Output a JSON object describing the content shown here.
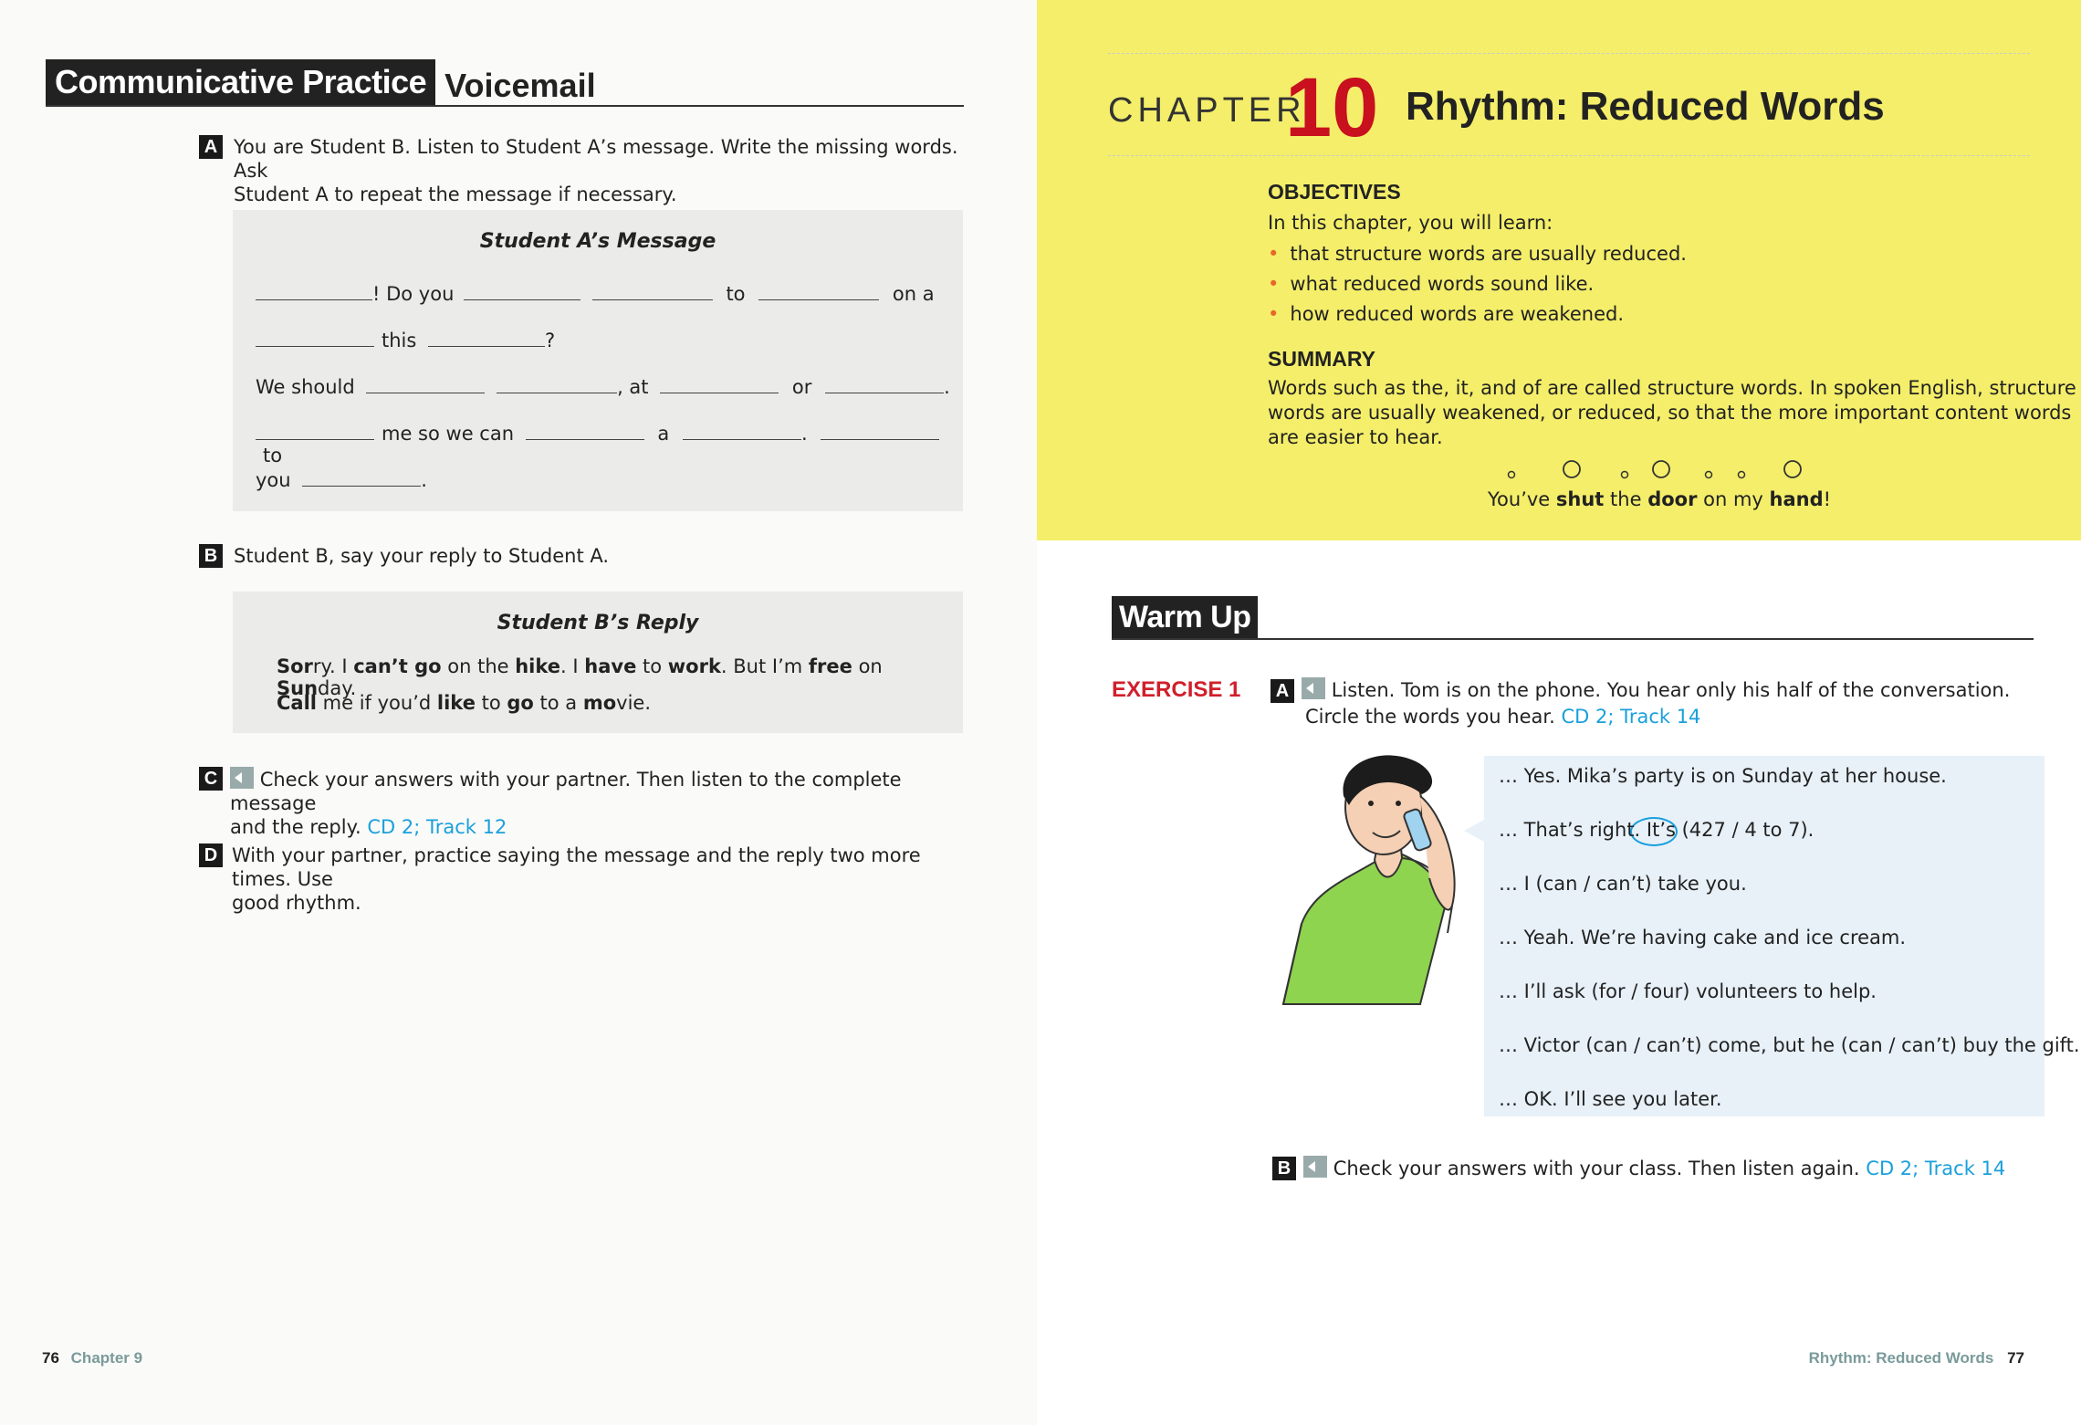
{
  "left": {
    "header_box": "Communicative Practice",
    "header_title": "Voicemail",
    "a_badge": "A",
    "a_text_1": "You are Student B. Listen to Student A’s message. Write the missing words. Ask",
    "a_text_2": "Student A to repeat the message if necessary.",
    "box_a_title": "Student A’s Message",
    "msg": {
      "r1_a": "! Do you",
      "r1_b": "to",
      "r1_c": "on a",
      "r2_a": "this",
      "r2_b": "?",
      "r3_a": "We should",
      "r3_b": ", at",
      "r3_c": "or",
      "r3_d": ".",
      "r4_a": "me so we can",
      "r4_b": "a",
      "r4_c": ".",
      "r4_d": "to",
      "r5_a": "you",
      "r5_b": "."
    },
    "b_badge": "B",
    "b_text": "Student B, say your reply to Student A.",
    "box_b_title": "Student B’s Reply",
    "reply_line1": [
      {
        "t": "Sor",
        "b": true
      },
      {
        "t": "ry. I ",
        "b": false
      },
      {
        "t": "can’t go",
        "b": true
      },
      {
        "t": " on the ",
        "b": false
      },
      {
        "t": "hike",
        "b": true
      },
      {
        "t": ". I ",
        "b": false
      },
      {
        "t": "have",
        "b": true
      },
      {
        "t": " to ",
        "b": false
      },
      {
        "t": "work",
        "b": true
      },
      {
        "t": ". But I’m ",
        "b": false
      },
      {
        "t": "free",
        "b": true
      },
      {
        "t": " on ",
        "b": false
      },
      {
        "t": "Sun",
        "b": true
      },
      {
        "t": "day.",
        "b": false
      }
    ],
    "reply_line2": [
      {
        "t": "Call",
        "b": true
      },
      {
        "t": " me if you’d ",
        "b": false
      },
      {
        "t": "like",
        "b": true
      },
      {
        "t": " to ",
        "b": false
      },
      {
        "t": "go",
        "b": true
      },
      {
        "t": " to a ",
        "b": false
      },
      {
        "t": "mo",
        "b": true
      },
      {
        "t": "vie.",
        "b": false
      }
    ],
    "c_badge": "C",
    "c_text_1": "Check your answers with your partner. Then listen to the complete message",
    "c_text_2": "and the reply.",
    "c_cd": "CD 2; Track 12",
    "d_badge": "D",
    "d_text_1": "With your partner, practice saying the message and the reply two more times. Use",
    "d_text_2": "good rhythm.",
    "footer_num": "76",
    "footer_chapter": "Chapter 9"
  },
  "right": {
    "chapter_word": "CHAPTER",
    "chapter_num": "10",
    "chapter_title": "Rhythm: Reduced Words",
    "objectives_head": "OBJECTIVES",
    "objectives_intro": "In this chapter, you will learn:",
    "objectives": [
      "that structure words are usually reduced.",
      "what reduced words sound like.",
      "how reduced words are weakened."
    ],
    "summary_head": "SUMMARY",
    "summary_lines": [
      "Words such as the, it, and of are called structure words. In spoken English, structure",
      "words are usually weakened, or reduced, so that the more important content words",
      "are easier to hear."
    ],
    "rhythm_words": [
      {
        "t": "You’ve ",
        "b": false
      },
      {
        "t": "shut",
        "b": true
      },
      {
        "t": " the ",
        "b": false
      },
      {
        "t": "door",
        "b": true
      },
      {
        "t": " on my ",
        "b": false
      },
      {
        "t": "hand",
        "b": true
      },
      {
        "t": "!",
        "b": false
      }
    ],
    "warmup": "Warm Up",
    "exercise_label": "EXERCISE 1",
    "ex_a_badge": "A",
    "ex_a_text_1": "Listen. Tom is on the phone. You hear only his half of the conversation.",
    "ex_a_text_2": "Circle the words you hear.",
    "ex_a_cd": "CD 2; Track 14",
    "dialogue": [
      "… Yes. Mika’s party is on Sunday at her house.",
      "… That’s right. It’s (427 / 4 to 7).",
      "… I (can / can’t) take you.",
      "… Yeah. We’re having cake and ice cream.",
      "… I’ll ask (for / four) volunteers to help.",
      "… Victor (can / can’t) come, but he (can / can’t) buy the gift.",
      "… OK. I’ll see you later."
    ],
    "ex_b_badge": "B",
    "ex_b_text": "Check your answers with your class. Then listen again.",
    "ex_b_cd": "CD 2; Track 14",
    "footer_title": "Rhythm: Reduced Words",
    "footer_num": "77"
  },
  "colors": {
    "accent_red": "#d01f2b",
    "cd_blue": "#1aa0dc",
    "chapter_yellow": "#f4ee6a",
    "bullet_orange": "#e8662a"
  }
}
